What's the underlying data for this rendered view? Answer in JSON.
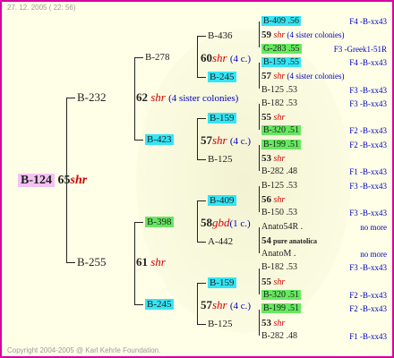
{
  "header": {
    "timestamp": "27. 12. 2005 ( 22: 56)"
  },
  "footer": {
    "copyright": "Copyright 2004-2005 @ Karl Kehrle Foundation."
  },
  "root": {
    "id": "B-124",
    "code": "65",
    "race": "shr"
  },
  "gen1": {
    "sire": {
      "id": "B-232",
      "code": "62",
      "race": "shr",
      "note": "(4 sister colonies)"
    },
    "dam": {
      "id": "B-255",
      "code": "61",
      "race": "shr"
    }
  },
  "gen2": {
    "s_s": "B-278",
    "s_d": "B-423",
    "d_s": "B-398",
    "d_d": "B-245"
  },
  "gen3": {
    "a": {
      "id": "B-436",
      "code": "60",
      "race": "shr",
      "note": "(4 c.)"
    },
    "b": {
      "id": "B-245"
    },
    "c": {
      "id": "B-159",
      "code": "57",
      "race": "shr",
      "note": "(4 c.)"
    },
    "d": {
      "id": "B-125"
    },
    "e": {
      "id": "B-409",
      "code": "58",
      "race": "gbd",
      "note": "(1 c.)"
    },
    "f": {
      "id": "A-442"
    },
    "g": {
      "id": "B-159",
      "code": "57",
      "race": "shr",
      "note": "(4 c.)"
    },
    "h": {
      "id": "B-125"
    }
  },
  "gen4": [
    {
      "text": "B-409 .56",
      "hl": "cyan",
      "right": "F4 -B-xx43"
    },
    {
      "text": "59",
      "race": "shr",
      "note": "(4 sister colonies)"
    },
    {
      "text": "G-283 .55",
      "hl": "green",
      "right": "F3 -Greek1-51R"
    },
    {
      "text": "B-159 .55",
      "hl": "cyan",
      "right": "F4 -B-xx43"
    },
    {
      "text": "57",
      "race": "shr",
      "note": "(4 sister colonies)"
    },
    {
      "text": "B-125 .53",
      "right": "F3 -B-xx43"
    },
    {
      "text": "B-182 .53",
      "right": "F3 -B-xx43"
    },
    {
      "text": "55",
      "race": "shr"
    },
    {
      "text": "B-320 .51",
      "hl": "green",
      "right": "F2 -B-xx43"
    },
    {
      "text": "B-199 .51",
      "hl": "green",
      "right": "F2 -B-xx43"
    },
    {
      "text": "53",
      "race": "shr"
    },
    {
      "text": "B-282 .48",
      "right": "F1 -B-xx43"
    },
    {
      "text": "B-125 .53",
      "right": "F3 -B-xx43"
    },
    {
      "text": "56",
      "race": "shr"
    },
    {
      "text": "B-150 .53",
      "right": "F3 -B-xx43"
    },
    {
      "text": "Anato54R .",
      "right": "no more"
    },
    {
      "text": "54",
      "race": "pure anatolica"
    },
    {
      "text": "AnatoM .",
      "right": "no more"
    },
    {
      "text": "B-182 .53",
      "right": "F3 -B-xx43"
    },
    {
      "text": "55",
      "race": "shr"
    },
    {
      "text": "B-320 .51",
      "hl": "green",
      "right": "F2 -B-xx43"
    },
    {
      "text": "B-199 .51",
      "hl": "green",
      "right": "F2 -B-xx43"
    },
    {
      "text": "53",
      "race": "shr"
    },
    {
      "text": "B-282 .48",
      "right": "F1 -B-xx43"
    }
  ]
}
